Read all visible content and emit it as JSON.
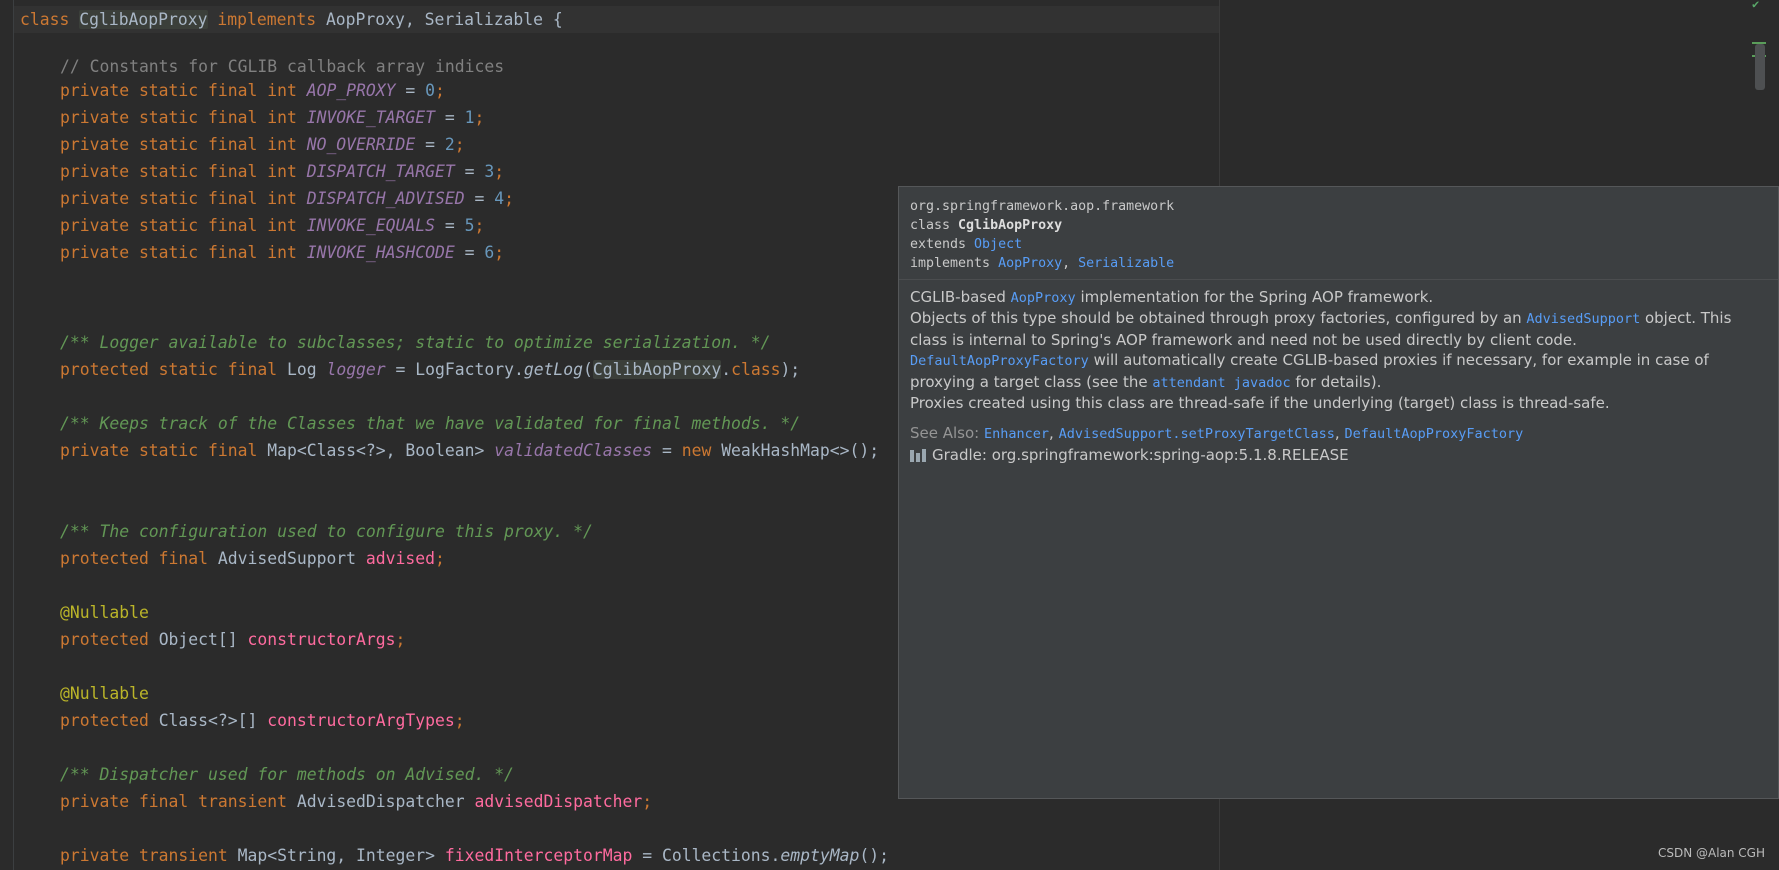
{
  "code_lines": {
    "l1": {
      "a": "class ",
      "b": "CglibAopProxy",
      "c": " implements ",
      "d": "AopProxy, Serializable {"
    },
    "l2": "// Constants for CGLIB callback array indices",
    "c1": {
      "mod": "private static final int ",
      "name": "AOP_PROXY",
      "eq": " = ",
      "val": "0",
      "semi": ";"
    },
    "c2": {
      "mod": "private static final int ",
      "name": "INVOKE_TARGET",
      "eq": " = ",
      "val": "1",
      "semi": ";"
    },
    "c3": {
      "mod": "private static final int ",
      "name": "NO_OVERRIDE",
      "eq": " = ",
      "val": "2",
      "semi": ";"
    },
    "c4": {
      "mod": "private static final int ",
      "name": "DISPATCH_TARGET",
      "eq": " = ",
      "val": "3",
      "semi": ";"
    },
    "c5": {
      "mod": "private static final int ",
      "name": "DISPATCH_ADVISED",
      "eq": " = ",
      "val": "4",
      "semi": ";"
    },
    "c6": {
      "mod": "private static final int ",
      "name": "INVOKE_EQUALS",
      "eq": " = ",
      "val": "5",
      "semi": ";"
    },
    "c7": {
      "mod": "private static final int ",
      "name": "INVOKE_HASHCODE",
      "eq": " = ",
      "val": "6",
      "semi": ";"
    },
    "d1": "/** Logger available to subclasses; static to optimize serialization. */",
    "l3": {
      "mod": "protected static final ",
      "type": "Log ",
      "name": "logger",
      "eq": " = LogFactory.",
      "call": "getLog",
      "open": "(",
      "arg": "CglibAopProxy",
      "dot": ".",
      "kw": "class",
      "close": ");"
    },
    "d2": "/** Keeps track of the Classes that we have validated for final methods. */",
    "l4": {
      "mod": "private static final ",
      "type": "Map<Class<?>, Boolean> ",
      "name": "validatedClasses",
      "eq": " = ",
      "kw": "new ",
      "rest": "WeakHashMap<>();"
    },
    "d3": "/** The configuration used to configure this proxy. */",
    "l5": {
      "mod": "protected final ",
      "type": "AdvisedSupport ",
      "name": "advised",
      "semi": ";"
    },
    "a1": "@Nullable",
    "l6": {
      "mod": "protected ",
      "type": "Object[] ",
      "name": "constructorArgs",
      "semi": ";"
    },
    "a2": "@Nullable",
    "l7": {
      "mod": "protected ",
      "type": "Class<?>[] ",
      "name": "constructorArgTypes",
      "semi": ";"
    },
    "d4": "/** Dispatcher used for methods on Advised. */",
    "l8": {
      "mod": "private final transient ",
      "type": "AdvisedDispatcher ",
      "name": "advisedDispatcher",
      "semi": ";"
    },
    "l9": {
      "mod": "private transient ",
      "type": "Map<String, Integer> ",
      "name": "fixedInterceptorMap",
      "eq": " = Collections.",
      "call": "emptyMap",
      "close": "();"
    }
  },
  "popup": {
    "package": "org.springframework.aop.framework",
    "class_kw": "class ",
    "class_name": "CglibAopProxy",
    "extends_kw": "extends ",
    "extends_link": "Object",
    "implements_kw": "implements ",
    "impl1": "AopProxy",
    "impl_sep": ", ",
    "impl2": "Serializable",
    "p1a": "CGLIB-based ",
    "p1link": "AopProxy",
    "p1b": " implementation for the Spring AOP framework.",
    "p2a": "Objects of this type should be obtained through proxy factories, configured by an ",
    "p2link": "AdvisedSupport",
    "p2b": " object. This class is internal to Spring's AOP framework and need not be used directly by client code.",
    "p3link": "DefaultAopProxyFactory",
    "p3a": " will automatically create CGLIB-based proxies if necessary, for example in case of proxying a target class (see the ",
    "p3link2": "attendant javadoc",
    "p3b": " for details).",
    "p4": "Proxies created using this class are thread-safe if the underlying (target) class is thread-safe.",
    "see_also_label": "See Also: ",
    "see1": "Enhancer",
    "see_sep1": ", ",
    "see2": "AdvisedSupport.setProxyTargetClass",
    "see_sep2": ", ",
    "see3": "DefaultAopProxyFactory",
    "gradle": "Gradle: org.springframework:spring-aop:5.1.8.RELEASE"
  },
  "watermark": "CSDN @Alan CGH",
  "colors": {
    "background": "#2b2b2b",
    "keyword": "#cc7832",
    "link": "#589df6"
  }
}
